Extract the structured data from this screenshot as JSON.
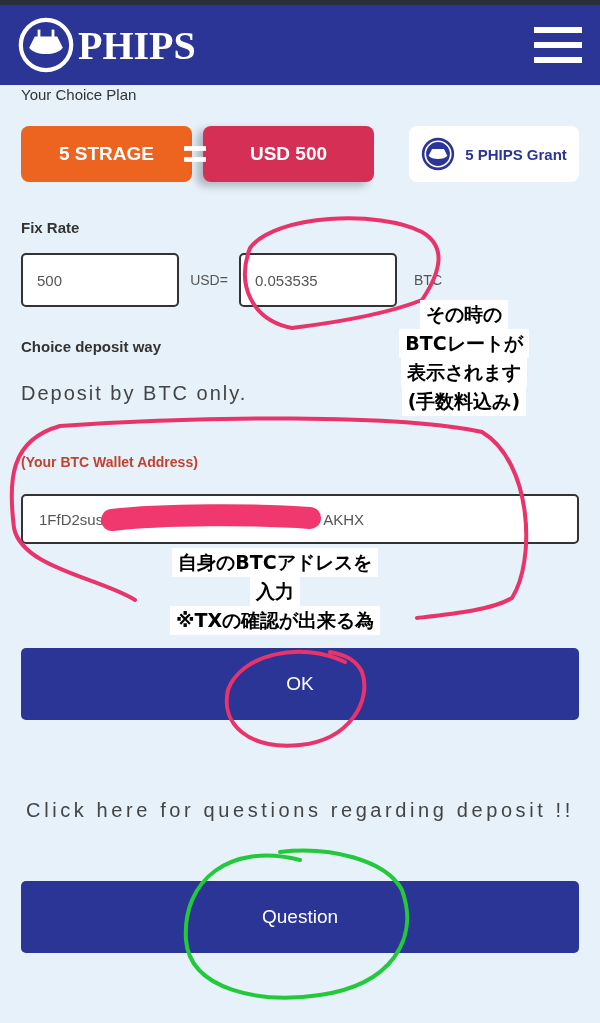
{
  "header": {
    "logo_text": "PHIPS"
  },
  "plan": {
    "label": "Your Choice Plan",
    "items": [
      {
        "text": "5 STRAGE",
        "color": "#ec6420"
      },
      {
        "text": "USD 500",
        "color": "#d52f55"
      }
    ],
    "grant": "5 PHIPS Grant"
  },
  "rate": {
    "label": "Fix Rate",
    "usd_value": "500",
    "usd_unit": "USD=",
    "btc_value": "0.053535",
    "btc_unit": "BTC"
  },
  "deposit": {
    "label": "Choice deposit way",
    "method": "Deposit by BTC only."
  },
  "wallet": {
    "label": "(Your BTC Wallet Address)",
    "value_start": "1FfD2sus",
    "value_end": "AKHX"
  },
  "ok_button": "OK",
  "help_text": "Click here for questions regarding deposit !!",
  "question_button": "Question",
  "annotations": [
    {
      "kind": "loop",
      "color": "#e8336b"
    },
    {
      "kind": "loop",
      "color": "#e8336b"
    },
    {
      "kind": "loop",
      "color": "#e8336b"
    },
    {
      "kind": "loop",
      "color": "#22c93a"
    },
    {
      "kind": "stroke",
      "color": "#f0386e"
    }
  ],
  "callouts": [
    {
      "lines": [
        "その時の",
        "BTCレートが",
        "表示されます",
        "(手数料込み)"
      ]
    },
    {
      "lines": [
        "自身のBTCアドレスを",
        "入力",
        "※TXの確認が出来る為"
      ]
    }
  ]
}
